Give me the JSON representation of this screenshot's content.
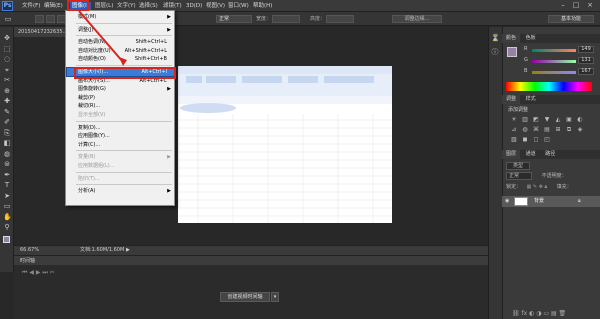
{
  "menubar": {
    "logo": "Ps",
    "items": [
      "文件(F)",
      "编辑(E)",
      "图像(I)",
      "图层(L)",
      "文字(Y)",
      "选择(S)",
      "滤镜(T)",
      "3D(D)",
      "视图(V)",
      "窗口(W)",
      "帮助(H)"
    ]
  },
  "options_bar": {
    "mode_label": "正常",
    "opacity_label": "宽度：",
    "height_label": "高度：",
    "refine_button": "调整边缘...",
    "workspace": "基本功能"
  },
  "document": {
    "tab_title": "20150417232635...",
    "zoom": "66.67%",
    "doc_info": "文档:1.60M/1.60M"
  },
  "timeline": {
    "title": "时间轴",
    "create_button": "创建视频时间轴"
  },
  "image_menu": {
    "items": [
      {
        "label": "模式(M)",
        "shortcut": "",
        "submenu": true,
        "disabled": false
      },
      {
        "sep": true
      },
      {
        "label": "调整(J)",
        "shortcut": "",
        "submenu": true,
        "disabled": false
      },
      {
        "sep": true
      },
      {
        "label": "自动色调(N)",
        "shortcut": "Shift+Ctrl+L",
        "submenu": false,
        "disabled": false
      },
      {
        "label": "自动对比度(U)",
        "shortcut": "Alt+Shift+Ctrl+L",
        "submenu": false,
        "disabled": false
      },
      {
        "label": "自动颜色(O)",
        "shortcut": "Shift+Ctrl+B",
        "submenu": false,
        "disabled": false
      },
      {
        "sep": true
      },
      {
        "label": "图像大小(I)...",
        "shortcut": "Alt+Ctrl+I",
        "submenu": false,
        "disabled": false,
        "highlight": true
      },
      {
        "label": "画布大小(S)...",
        "shortcut": "Alt+Ctrl+C",
        "submenu": false,
        "disabled": false
      },
      {
        "label": "图像旋转(G)",
        "shortcut": "",
        "submenu": true,
        "disabled": false
      },
      {
        "label": "裁剪(P)",
        "shortcut": "",
        "submenu": false,
        "disabled": false
      },
      {
        "label": "裁切(R)...",
        "shortcut": "",
        "submenu": false,
        "disabled": false
      },
      {
        "label": "显示全部(V)",
        "shortcut": "",
        "submenu": false,
        "disabled": true
      },
      {
        "sep": true
      },
      {
        "label": "复制(D)...",
        "shortcut": "",
        "submenu": false,
        "disabled": false
      },
      {
        "label": "应用图像(Y)...",
        "shortcut": "",
        "submenu": false,
        "disabled": false
      },
      {
        "label": "计算(C)...",
        "shortcut": "",
        "submenu": false,
        "disabled": false
      },
      {
        "sep": true
      },
      {
        "label": "变量(B)",
        "shortcut": "",
        "submenu": true,
        "disabled": true
      },
      {
        "label": "应用数据组(L)...",
        "shortcut": "",
        "submenu": false,
        "disabled": true
      },
      {
        "sep": true
      },
      {
        "label": "陷印(T)...",
        "shortcut": "",
        "submenu": false,
        "disabled": true
      },
      {
        "sep": true
      },
      {
        "label": "分析(A)",
        "shortcut": "",
        "submenu": true,
        "disabled": false
      }
    ]
  },
  "color_panel": {
    "tabs": [
      "颜色",
      "色板"
    ],
    "r_label": "R",
    "g_label": "G",
    "b_label": "B",
    "r": "149",
    "g": "131",
    "b": "167"
  },
  "adjust_panel": {
    "tabs": [
      "调整",
      "样式"
    ],
    "hint": "添加调整"
  },
  "layers_panel": {
    "tabs": [
      "图层",
      "通道",
      "路径"
    ],
    "kind_label": "类型",
    "blend_mode": "正常",
    "opacity_label": "不透明度：",
    "lock_label": "锁定：",
    "fill_label": "填充：",
    "layer_name": "背景"
  },
  "colors": {
    "accent": "#3a7bd5",
    "annotation": "#d9241c"
  }
}
